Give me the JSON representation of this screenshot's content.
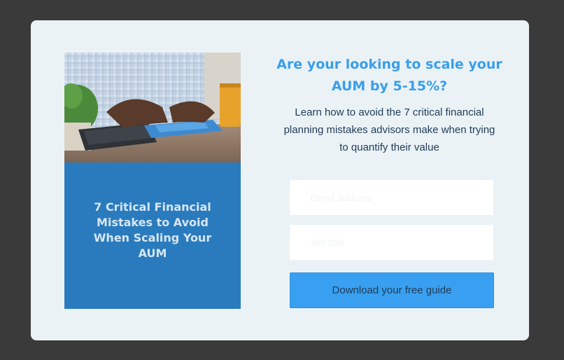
{
  "cover": {
    "title": "7 Critical Financial Mistakes to Avoid When Scaling Your AUM",
    "photo_icon": "office-desk-calculator-photo"
  },
  "offer": {
    "headline": "Are your looking to scale your AUM by 5-15%?",
    "description": "Learn how to avoid the 7 critical financial planning mistakes advisors make when trying to quantify their value"
  },
  "form": {
    "email_placeholder": "Email address",
    "job_placeholder": "Job title",
    "submit_label": "Download your free guide"
  },
  "colors": {
    "overlay": "#3a3a3a",
    "modal": "#eaf2f6",
    "accent": "#39a0f1",
    "cover": "#2a7bbd",
    "heading": "#3a9eea"
  }
}
